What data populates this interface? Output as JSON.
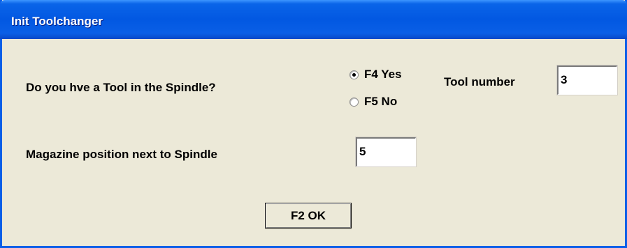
{
  "window": {
    "title": "Init Toolchanger"
  },
  "spindle_question": {
    "label": "Do  you hve a Tool in the Spindle?",
    "options": [
      {
        "label": "F4 Yes",
        "selected": true
      },
      {
        "label": "F5 No",
        "selected": false
      }
    ]
  },
  "tool_number": {
    "label": "Tool number",
    "value": "3"
  },
  "magazine_position": {
    "label": "Magazine position next to Spindle",
    "value": "5"
  },
  "ok_button": {
    "label": "F2 OK"
  },
  "colors": {
    "title_bar": "#0258e2",
    "dialog_background": "#ece9d8"
  }
}
